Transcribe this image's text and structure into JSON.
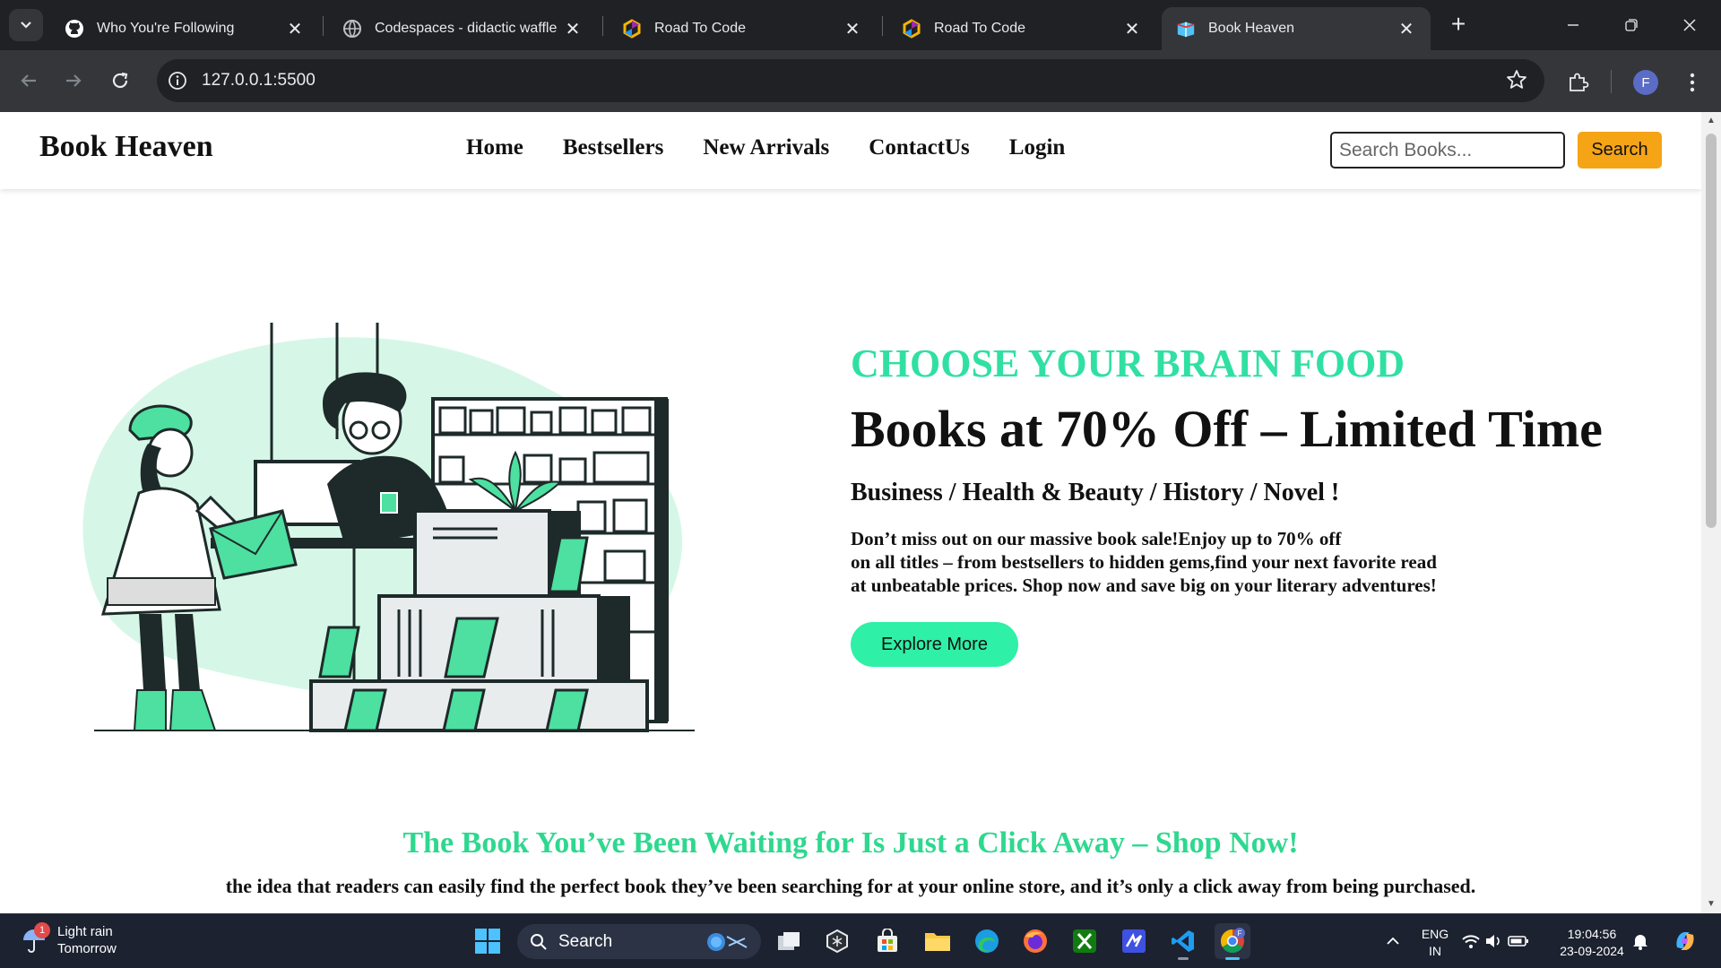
{
  "browser": {
    "tabs": [
      {
        "title": "Who You're Following",
        "icon": "github-icon"
      },
      {
        "title": "Codespaces - didactic waffle",
        "icon": "globe-icon"
      },
      {
        "title": "Road To Code",
        "icon": "roadtocode-icon"
      },
      {
        "title": "Road To Code",
        "icon": "roadtocode-icon"
      },
      {
        "title": "Book Heaven",
        "icon": "book-icon",
        "active": true
      }
    ],
    "url": "127.0.0.1:5500",
    "profile_initial": "F"
  },
  "site": {
    "logo": "Book Heaven",
    "nav": [
      "Home",
      "Bestsellers",
      "New Arrivals",
      "ContactUs",
      "Login"
    ],
    "search_placeholder": "Search Books...",
    "search_button": "Search"
  },
  "hero": {
    "eyebrow": "CHOOSE YOUR BRAIN FOOD",
    "headline": "Books at 70% Off – Limited Time",
    "categories": "Business / Health & Beauty / History / Novel !",
    "description_lines": [
      "Don’t miss out on our massive book sale!Enjoy up to 70% off",
      "on all titles – from bestsellers to hidden gems,find your next favorite read",
      "at unbeatable prices. Shop now and save big on your literary adventures!"
    ],
    "cta_button": "Explore More"
  },
  "promo": {
    "title": "The Book You’ve Been Waiting for Is Just a Click Away – Shop Now!",
    "subtitle": "the idea that readers can easily find the perfect book they’ve been searching for at your online store, and it’s only a click away from being purchased."
  },
  "colors": {
    "accent_green": "#30e0a3",
    "button_green": "#2ef0a6",
    "search_orange": "#f5a416",
    "chrome_dark": "#202124"
  },
  "taskbar": {
    "weather_title": "Light rain",
    "weather_sub": "Tomorrow",
    "weather_badge": "1",
    "search_label": "Search",
    "lang_top": "ENG",
    "lang_bottom": "IN",
    "time": "19:04:56",
    "date": "23-09-2024"
  }
}
